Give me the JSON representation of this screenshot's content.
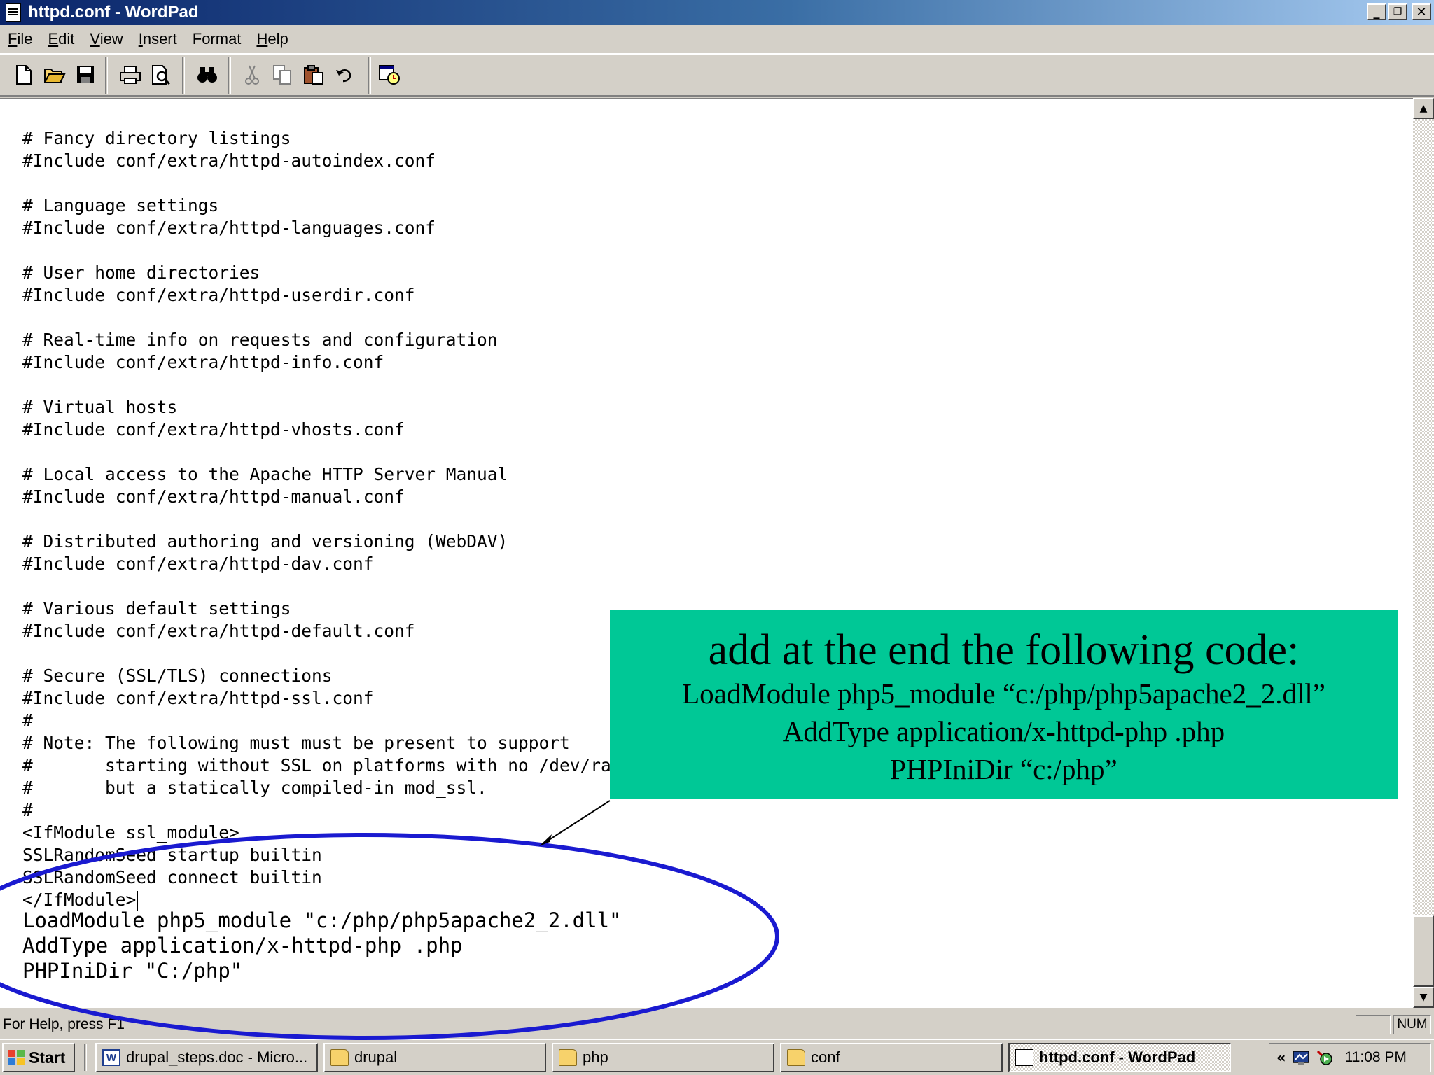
{
  "window": {
    "title": "httpd.conf - WordPad"
  },
  "menu": [
    {
      "accel": "F",
      "rest": "ile"
    },
    {
      "accel": "E",
      "rest": "dit"
    },
    {
      "accel": "V",
      "rest": "iew"
    },
    {
      "accel": "I",
      "rest": "nsert"
    },
    {
      "accel": "",
      "rest": "Format"
    },
    {
      "accel": "H",
      "rest": "elp"
    }
  ],
  "toolbar": {
    "icons": [
      "new-document-icon",
      "open-folder-icon",
      "save-icon",
      "print-icon",
      "print-preview-icon",
      "find-icon",
      "cut-icon",
      "copy-icon",
      "paste-icon",
      "undo-icon",
      "date-time-icon"
    ]
  },
  "document": {
    "lines": [
      "# Fancy directory listings",
      "#Include conf/extra/httpd-autoindex.conf",
      "",
      "# Language settings",
      "#Include conf/extra/httpd-languages.conf",
      "",
      "# User home directories",
      "#Include conf/extra/httpd-userdir.conf",
      "",
      "# Real-time info on requests and configuration",
      "#Include conf/extra/httpd-info.conf",
      "",
      "# Virtual hosts",
      "#Include conf/extra/httpd-vhosts.conf",
      "",
      "# Local access to the Apache HTTP Server Manual",
      "#Include conf/extra/httpd-manual.conf",
      "",
      "# Distributed authoring and versioning (WebDAV)",
      "#Include conf/extra/httpd-dav.conf",
      "",
      "# Various default settings",
      "#Include conf/extra/httpd-default.conf",
      "",
      "# Secure (SSL/TLS) connections",
      "#Include conf/extra/httpd-ssl.conf",
      "#",
      "# Note: The following must must be present to support",
      "#       starting without SSL on platforms with no /dev/random equivalent",
      "#       but a statically compiled-in mod_ssl.",
      "#",
      "<IfModule ssl_module>",
      "SSLRandomSeed startup builtin",
      "SSLRandomSeed connect builtin",
      "</IfModule>"
    ],
    "added_lines": [
      "LoadModule php5_module \"c:/php/php5apache2_2.dll\"",
      "AddType application/x-httpd-php .php",
      "PHPIniDir \"C:/php\""
    ]
  },
  "annotation": {
    "heading": "add at the end the following code:",
    "lines": [
      "LoadModule php5_module “c:/php/php5apache2_2.dll”",
      "AddType application/x-httpd-php .php",
      "PHPIniDir “c:/php”"
    ],
    "box_color": "#00c896",
    "ellipse_color": "#1a1ad0"
  },
  "status": {
    "text": "For Help, press F1",
    "num": "NUM"
  },
  "taskbar": {
    "start": "Start",
    "items": [
      {
        "label": "drupal_steps.doc - Micro...",
        "icon": "word-icon"
      },
      {
        "label": "drupal",
        "icon": "folder-icon"
      },
      {
        "label": "php",
        "icon": "folder-icon"
      },
      {
        "label": "conf",
        "icon": "folder-icon"
      },
      {
        "label": "httpd.conf - WordPad",
        "icon": "wordpad-icon"
      }
    ],
    "clock": "11:08 PM"
  }
}
